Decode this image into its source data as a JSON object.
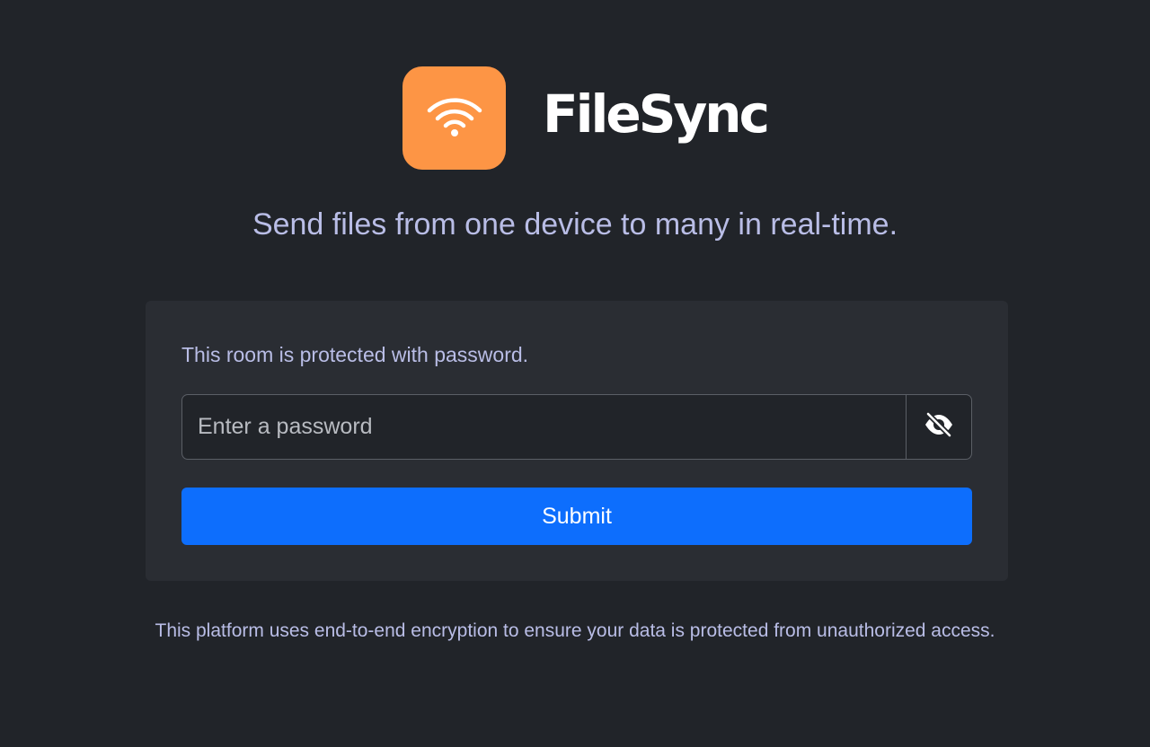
{
  "brand": {
    "name": "FileSync",
    "logo_icon": "wifi-icon",
    "logo_color": "#fd9545"
  },
  "tagline": "Send files from one device to many in real-time.",
  "password_form": {
    "prompt": "This room is protected with password.",
    "input_placeholder": "Enter a password",
    "input_value": "",
    "toggle_icon": "eye-slash-icon",
    "submit_label": "Submit"
  },
  "footer_note": "This platform uses end-to-end encryption to ensure your data is protected from unauthorized access.",
  "colors": {
    "background": "#212429",
    "card": "#2a2d33",
    "accent": "#0d6efd",
    "text_muted": "#b9bde6"
  }
}
